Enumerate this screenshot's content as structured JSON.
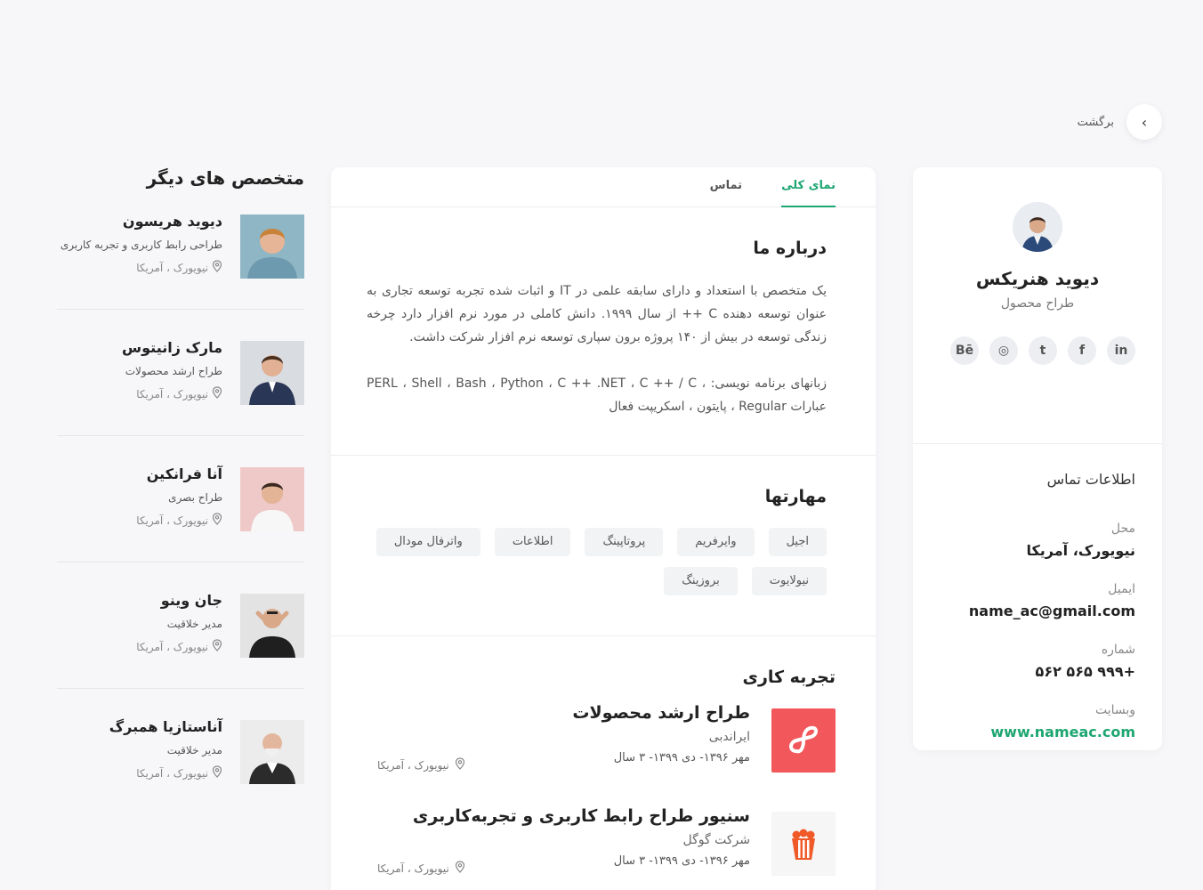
{
  "back": {
    "label": "برگشت"
  },
  "profile": {
    "name": "دیوید هنریکس",
    "role": "طراح محصول",
    "socials": [
      {
        "icon": "linkedin-icon",
        "glyph": "in"
      },
      {
        "icon": "facebook-icon",
        "glyph": "f"
      },
      {
        "icon": "twitter-icon",
        "glyph": "t"
      },
      {
        "icon": "dribbble-icon",
        "glyph": "◎"
      },
      {
        "icon": "behance-icon",
        "glyph": "Bē"
      }
    ],
    "contact_title": "اطلاعات تماس",
    "location_label": "محل",
    "location": "نیویورک، آمریکا",
    "email_label": "ایمیل",
    "email": "name_ac@gmail.com",
    "phone_label": "شماره",
    "phone": "+۹۹۹ ۵۶۵ ۵۶۲",
    "website_label": "وبسایت",
    "website": "www.nameac.com"
  },
  "tabs": [
    "نمای کلی",
    "تماس"
  ],
  "about": {
    "title": "درباره ما",
    "p1": "یک متخصص با استعداد و دارای سابقه علمی در IT و اثبات شده تجربه توسعه تجاری به عنوان توسعه دهنده C ++ از سال ۱۹۹۹. دانش کاملی در مورد نرم افزار دارد چرخه زندگی توسعه در بیش از ۱۴۰ پروژه برون سپاری توسعه نرم افزار شرکت داشت.",
    "p2": "زبانهای برنامه نویسی: ، PERL ، Shell ، Bash ، Python ، C ++ .NET ، C ++ / C عبارات Regular ، پایتون ، اسکریپت فعال"
  },
  "skills": {
    "title": "مهارتها",
    "items": [
      "اجیل",
      "وایرفریم",
      "پروتاپینگ",
      "اطلاعات",
      "واترفال مودال",
      "نیولایوت",
      "بروزینگ"
    ]
  },
  "experience": {
    "title": "تجربه کاری",
    "items": [
      {
        "title": "طراح ارشد محصولات",
        "company": "ایراندبی",
        "date": "مهر ۱۳۹۶- دی ۱۳۹۹- ۳ سال",
        "location": "نیویورک ، آمریکا",
        "logo_color": "#f2585b"
      },
      {
        "title": "سنیور طراح رابط کاربری و تجربه‌کاربری",
        "company": "شرکت گوگل",
        "date": "مهر ۱۳۹۶- دی ۱۳۹۹- ۳ سال",
        "location": "نیویورک ، آمریکا",
        "logo_color": "#f05a28"
      }
    ]
  },
  "others": {
    "title": "متخصص های دیگر",
    "people": [
      {
        "name": "دیوید هریسون",
        "role": "طراحی رابط کاربری و تجربه کاربری",
        "location": "نیویورک ، آمریکا"
      },
      {
        "name": "مارک زانیتوس",
        "role": "طراح ارشد محصولات",
        "location": "نیویورک ، آمریکا"
      },
      {
        "name": "آنا فرانکین",
        "role": "طراح بصری",
        "location": "نیویورک ، آمریکا"
      },
      {
        "name": "جان وینو",
        "role": "مدیر خلاقیت",
        "location": "نیویورک ، آمریکا"
      },
      {
        "name": "آناستازیا همبرگ",
        "role": "مدیر خلاقیت",
        "location": "نیویورک ، آمریکا"
      }
    ]
  }
}
